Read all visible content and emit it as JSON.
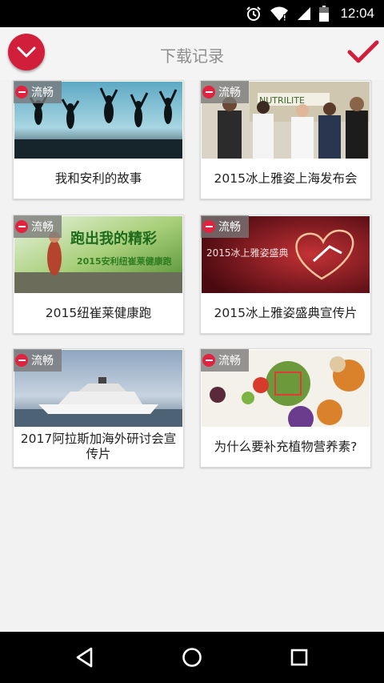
{
  "status_bar": {
    "time": "12:04",
    "icons": [
      "alarm-icon",
      "wifi-icon",
      "signal-icon",
      "battery-icon"
    ]
  },
  "header": {
    "title": "下载记录",
    "menu_icon": "chevron-down-icon",
    "confirm_icon": "check-icon"
  },
  "colors": {
    "accent": "#d11f3b",
    "badge_minus": "#e0233e",
    "background": "#f2f2f2"
  },
  "videos": [
    {
      "title": "我和安利的故事",
      "quality": "流畅"
    },
    {
      "title": "2015冰上雅姿上海发布会",
      "quality": "流畅",
      "thumb_text": "NUTRILITE"
    },
    {
      "title": "2015纽崔莱健康跑",
      "quality": "流畅",
      "thumb_text": "跑出我的精彩",
      "thumb_subtext": "2015安利纽崔莱健康跑"
    },
    {
      "title": "2015冰上雅姿盛典宣传片",
      "quality": "流畅",
      "thumb_text": "2015冰上雅姿盛典"
    },
    {
      "title": "2017阿拉斯加海外研讨会宣传片",
      "quality": "流畅"
    },
    {
      "title": "为什么要补充植物营养素?",
      "quality": "流畅"
    }
  ],
  "nav_bar": {
    "icons": [
      "back-icon",
      "home-icon",
      "recents-icon"
    ]
  }
}
